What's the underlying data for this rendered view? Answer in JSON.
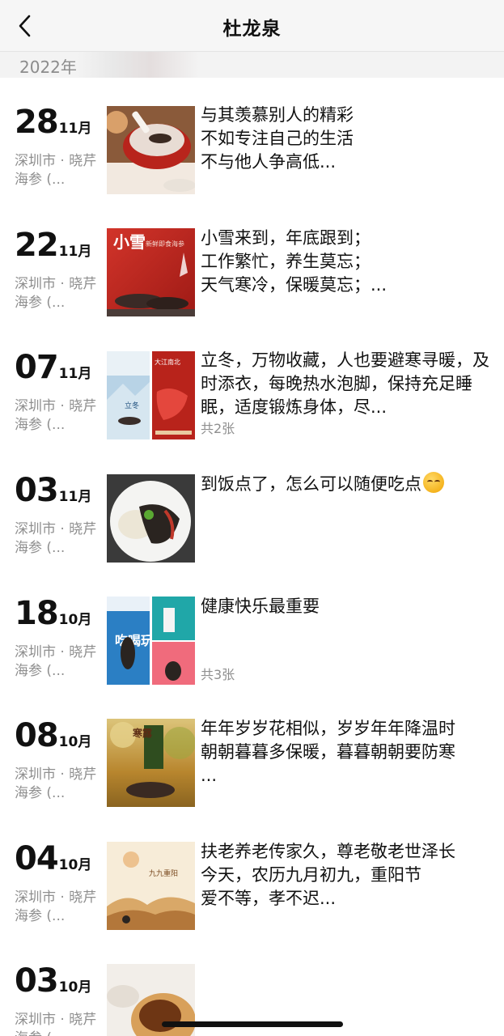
{
  "nav": {
    "title": "杜龙泉",
    "back_icon": "chevron-left-icon"
  },
  "year": "2022年",
  "entries": [
    {
      "day": "28",
      "month": "11月",
      "location": "深圳市 · 晓芹海参 (...",
      "text": "与其羡慕别人的精彩\n不如专注自己的生活\n不与他人争高低...",
      "photo_count": ""
    },
    {
      "day": "22",
      "month": "11月",
      "location": "深圳市 · 晓芹海参 (...",
      "text": "小雪来到，年底跟到；\n工作繁忙，养生莫忘；\n天气寒冷，保暖莫忘；...",
      "photo_count": ""
    },
    {
      "day": "07",
      "month": "11月",
      "location": "深圳市 · 晓芹海参 (...",
      "text": "立冬，万物收藏，人也要避寒寻暖，及时添衣，每晚热水泡脚，保持充足睡眠，适度锻炼身体，尽...",
      "photo_count": "共2张"
    },
    {
      "day": "03",
      "month": "11月",
      "location": "深圳市 · 晓芹海参 (...",
      "text": "到饭点了，怎么可以随便吃点",
      "photo_count": ""
    },
    {
      "day": "18",
      "month": "10月",
      "location": "深圳市 · 晓芹海参 (...",
      "text": "健康快乐最重要",
      "photo_count": "共3张"
    },
    {
      "day": "08",
      "month": "10月",
      "location": "深圳市 · 晓芹海参 (...",
      "text": "年年岁岁花相似，岁岁年年降温时\n朝朝暮暮多保暖，暮暮朝朝要防寒\n ...",
      "photo_count": ""
    },
    {
      "day": "04",
      "month": "10月",
      "location": "深圳市 · 晓芹海参 (...",
      "text": "扶老养老传家久，尊老敬老世泽长\n今天，农历九月初九，重阳节\n爱不等，孝不迟...",
      "photo_count": ""
    },
    {
      "day": "03",
      "month": "10月",
      "location": "深圳市 · 晓芹海参 (...",
      "text": "",
      "photo_count": ""
    }
  ],
  "thumbnail_text": {
    "t2_big": "小雪",
    "t2_small": "新鲜即食海参",
    "t3_left": "立冬",
    "t3_right": "大江南北",
    "t5_tags": "吃喝玩乐",
    "t6_text": "寒露",
    "t7_text": "九九重阳"
  }
}
